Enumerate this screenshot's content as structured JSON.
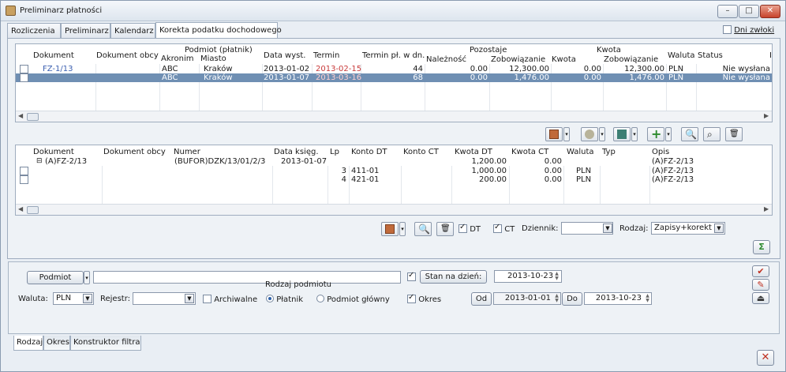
{
  "window": {
    "title": "Preliminarz płatności"
  },
  "colors": {
    "selection": "#6f8fb3",
    "date_red": "#c83a3a",
    "doc_blue": "#3b5fb0",
    "accent_green": "#2d8a2d"
  },
  "top_tabs": [
    "Rozliczenia",
    "Preliminarz",
    "Kalendarz",
    "Korekta podatku dochodowego"
  ],
  "dni_zwloki": {
    "label": "Dni zwłoki",
    "checked": false
  },
  "grid1": {
    "headers": {
      "dokument": "Dokument",
      "dokument_obcy": "Dokument obcy",
      "podmiot": "Podmiot (płatnik)",
      "akronim": "Akronim",
      "miasto": "Miasto",
      "data_wyst": "Data wyst.",
      "termin": "Termin",
      "termin_pl": "Termin pł. w dn.",
      "pozostaje": "Pozostaje",
      "naleznosc": "Należność",
      "zobowiazanie": "Zobowiązanie",
      "kwota_grp": "Kwota",
      "kwota": "Kwota",
      "zobowiazanie2": "Zobowiązanie",
      "waluta": "Waluta",
      "status": "Status"
    },
    "rows": [
      {
        "dokument": "FZ-1/13",
        "akronim": "ABC",
        "miasto": "Kraków",
        "data_wyst": "2013-01-02",
        "termin": "2013-02-15",
        "termin_pl": "44",
        "naleznosc": "0.00",
        "zobowiazanie": "12,300.00",
        "kwota": "0.00",
        "zobowiazanie2": "12,300.00",
        "waluta": "PLN",
        "status": "Nie wysłana"
      },
      {
        "dokument": "",
        "akronim": "ABC",
        "miasto": "Kraków",
        "data_wyst": "2013-01-07",
        "termin": "2013-03-16",
        "termin_pl": "68",
        "naleznosc": "0.00",
        "zobowiazanie": "1,476.00",
        "kwota": "0.00",
        "zobowiazanie2": "1,476.00",
        "waluta": "PLN",
        "status": "Nie wysłana"
      }
    ]
  },
  "grid2": {
    "headers": {
      "dokument": "Dokument",
      "dokument_obcy": "Dokument obcy",
      "numer": "Numer",
      "data_ksieg": "Data księg.",
      "lp": "Lp",
      "konto_dt": "Konto DT",
      "konto_ct": "Konto CT",
      "kwota_dt": "Kwota DT",
      "kwota_ct": "Kwota CT",
      "waluta": "Waluta",
      "typ": "Typ",
      "opis": "Opis"
    },
    "group": {
      "dokument": "(A)FZ-2/13",
      "numer": "(BUFOR)DZK/13/01/2/3",
      "data_ksieg": "2013-01-07",
      "kwota_dt": "1,200.00",
      "kwota_ct": "0.00",
      "opis": "(A)FZ-2/13"
    },
    "rows": [
      {
        "lp": "3",
        "konto_dt": "411-01",
        "kwota_dt": "1,000.00",
        "kwota_ct": "0.00",
        "waluta": "PLN",
        "opis": "(A)FZ-2/13"
      },
      {
        "lp": "4",
        "konto_dt": "421-01",
        "kwota_dt": "200.00",
        "kwota_ct": "0.00",
        "waluta": "PLN",
        "opis": "(A)FZ-2/13"
      }
    ]
  },
  "grid2_toolbar": {
    "dt_label": "DT",
    "ct_label": "CT",
    "dziennik_label": "Dziennik:",
    "dziennik_value": "",
    "rodzaj_label": "Rodzaj:",
    "rodzaj_value": "Zapisy+korekt"
  },
  "filter": {
    "podmiot_button": "Podmiot",
    "podmiot_value": "",
    "waluta_label": "Waluta:",
    "waluta_value": "PLN",
    "rejestr_label": "Rejestr:",
    "rejestr_value": "",
    "archiwalne_label": "Archiwalne",
    "rodzaj_podmiotu_label": "Rodzaj podmiotu",
    "platnik_label": "Płatnik",
    "podmiot_glowny_label": "Podmiot główny",
    "stan_na_dzien_button": "Stan na dzień:",
    "stan_na_dzien_value": "2013-10-23",
    "okres_label": "Okres",
    "od_button": "Od",
    "od_value": "2013-01-01",
    "do_button": "Do",
    "do_value": "2013-10-23"
  },
  "bottom_tabs": [
    "Rodzaj",
    "Okres",
    "Konstruktor filtra"
  ]
}
